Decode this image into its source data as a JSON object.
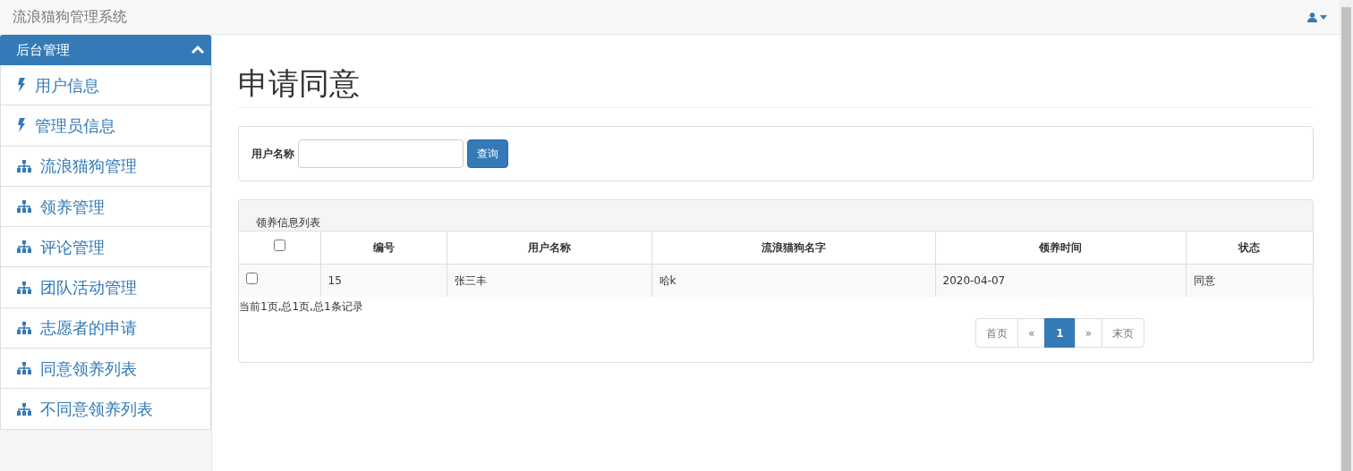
{
  "navbar": {
    "brand": "流浪猫狗管理系统"
  },
  "sidebar": {
    "title": "后台管理",
    "expanded": true,
    "items": [
      {
        "label": "用户信息",
        "kind": "bolt"
      },
      {
        "label": "管理员信息",
        "kind": "bolt"
      },
      {
        "label": "流浪猫狗管理",
        "kind": "sitemap"
      },
      {
        "label": "领养管理",
        "kind": "sitemap"
      },
      {
        "label": "评论管理",
        "kind": "sitemap"
      },
      {
        "label": "团队活动管理",
        "kind": "sitemap"
      },
      {
        "label": "志愿者的申请",
        "kind": "sitemap"
      },
      {
        "label": "同意领养列表",
        "kind": "sitemap"
      },
      {
        "label": "不同意领养列表",
        "kind": "sitemap"
      }
    ]
  },
  "page_title": "申请同意",
  "search": {
    "label": "用户名称",
    "button": "查询"
  },
  "table": {
    "caption": "领养信息列表",
    "select_all_checked": false,
    "columns": [
      "编号",
      "用户名称",
      "流浪猫狗名字",
      "领养时间",
      "状态"
    ],
    "rows": [
      {
        "checked": false,
        "cells": [
          "15",
          "张三丰",
          "哈k",
          "2020-04-07",
          "同意"
        ]
      }
    ]
  },
  "summary": "当前1页,总1页,总1条记录",
  "pagination": [
    {
      "label": "首页",
      "selected": false
    },
    {
      "label": "«",
      "selected": false
    },
    {
      "label": "1",
      "selected": true
    },
    {
      "label": "»",
      "selected": false
    },
    {
      "label": "末页",
      "selected": false
    }
  ]
}
